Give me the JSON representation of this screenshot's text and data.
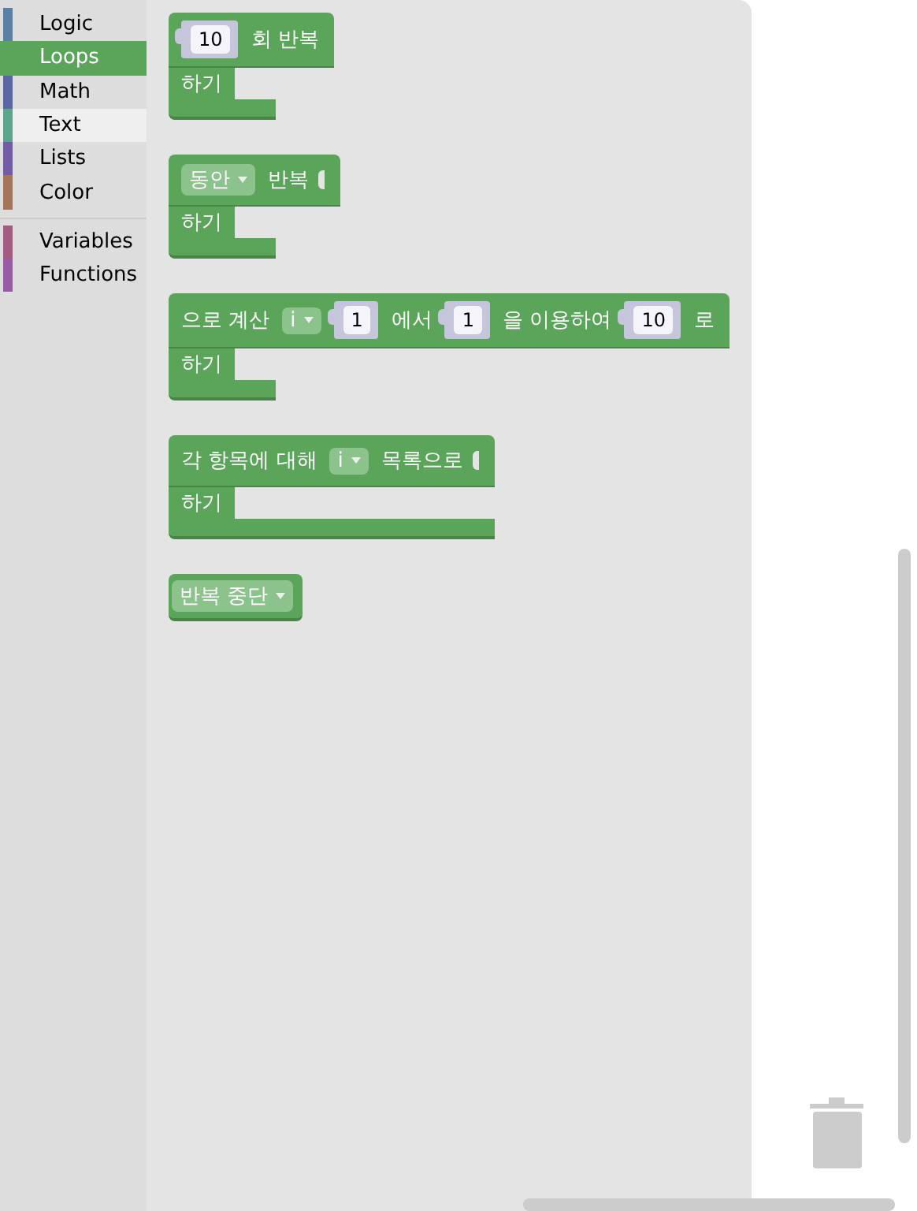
{
  "toolbox": {
    "groups": [
      {
        "items": [
          {
            "label": "Logic",
            "color": "#5b80a5",
            "selected": false,
            "hovered": false
          },
          {
            "label": "Loops",
            "color": "#5ba55b",
            "selected": true,
            "hovered": false
          },
          {
            "label": "Math",
            "color": "#5b67a5",
            "selected": false,
            "hovered": false
          },
          {
            "label": "Text",
            "color": "#5ba58c",
            "selected": false,
            "hovered": true
          },
          {
            "label": "Lists",
            "color": "#745ba5",
            "selected": false,
            "hovered": false
          },
          {
            "label": "Color",
            "color": "#a5745b",
            "selected": false,
            "hovered": false
          }
        ]
      },
      {
        "items": [
          {
            "label": "Variables",
            "color": "#a55b80",
            "selected": false,
            "hovered": false
          },
          {
            "label": "Functions",
            "color": "#995ba5",
            "selected": false,
            "hovered": false
          }
        ]
      }
    ]
  },
  "flyout": {
    "blocks": [
      {
        "parts": [
          {
            "kind": "number",
            "text": "10"
          },
          {
            "kind": "label",
            "text": "회 반복"
          }
        ],
        "statement": "하기"
      },
      {
        "parts": [
          {
            "kind": "dropdown",
            "text": "동안"
          },
          {
            "kind": "label",
            "text": "반복"
          },
          {
            "kind": "socket"
          }
        ],
        "statement": "하기"
      },
      {
        "parts": [
          {
            "kind": "label",
            "text": "으로 계산"
          },
          {
            "kind": "dropdown",
            "text": "i"
          },
          {
            "kind": "number",
            "text": "1"
          },
          {
            "kind": "label",
            "text": "에서"
          },
          {
            "kind": "number",
            "text": "1"
          },
          {
            "kind": "label",
            "text": "을 이용하여"
          },
          {
            "kind": "number",
            "text": "10"
          },
          {
            "kind": "label",
            "text": "로"
          }
        ],
        "statement": "하기"
      },
      {
        "parts": [
          {
            "kind": "label",
            "text": "각 항목에 대해"
          },
          {
            "kind": "dropdown",
            "text": "i"
          },
          {
            "kind": "label",
            "text": "목록으로"
          },
          {
            "kind": "socket"
          }
        ],
        "statement": "하기",
        "wide_bottom": true
      },
      {
        "parts": [
          {
            "kind": "dropdown",
            "text": "반복 중단"
          }
        ]
      }
    ]
  }
}
